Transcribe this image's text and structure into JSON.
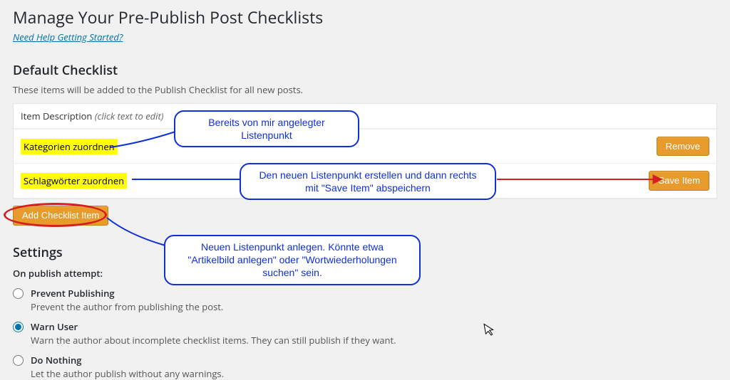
{
  "page": {
    "title": "Manage Your Pre-Publish Post Checklists",
    "help_link": "Need Help Getting Started?"
  },
  "default_checklist": {
    "heading": "Default Checklist",
    "description": "These items will be added to the Publish Checklist for all new posts.",
    "column_label": "Item Description",
    "column_hint": "(click text to edit)",
    "items": [
      {
        "text": "Kategorien zuordnen",
        "action_label": "Remove"
      },
      {
        "text": "Schlagwörter zuordnen",
        "action_label": "Save Item"
      }
    ],
    "add_button": "Add Checklist Item"
  },
  "settings": {
    "heading": "Settings",
    "prompt": "On publish attempt:",
    "options": [
      {
        "id": "prevent",
        "label": "Prevent Publishing",
        "desc": "Prevent the author from publishing the post.",
        "checked": false
      },
      {
        "id": "warn",
        "label": "Warn User",
        "desc": "Warn the author about incomplete checklist items. They can still publish if they want.",
        "checked": true
      },
      {
        "id": "nothing",
        "label": "Do Nothing",
        "desc": "Let the author publish without any warnings.",
        "checked": false
      }
    ]
  },
  "annotations": {
    "existing_item": "Bereits von mir angelegter Listenpunkt",
    "save_item": "Den neuen Listenpunkt erstellen und dann rechts mit \"Save Item\" abspeichern",
    "add_item": "Neuen Listenpunkt anlegen. Könnte etwa \"Artikelbild anlegen\" oder \"Wortwiederholungen suchen\" sein."
  },
  "colors": {
    "accent_orange": "#e69b2c",
    "link_blue": "#0073aa",
    "annotation_blue": "#1030d8",
    "highlight_yellow": "#ffff00",
    "annotation_red": "#d42020"
  }
}
